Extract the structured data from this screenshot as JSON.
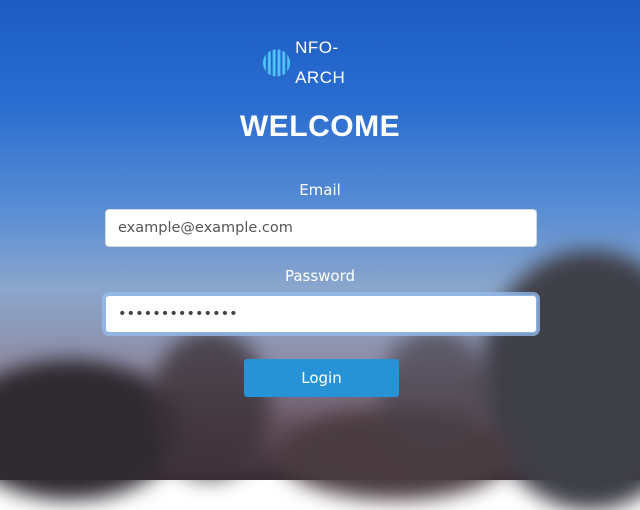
{
  "brand": {
    "name": "NFO-ARCH",
    "logo_icon": "striped-globe-icon"
  },
  "title": "WELCOME",
  "form": {
    "email_label": "Email",
    "email_placeholder": "example@example.com",
    "password_label": "Password",
    "password_value": "••••••••••••••",
    "login_label": "Login"
  },
  "colors": {
    "button": "#2793d6",
    "sky_top": "#1c5cc2"
  }
}
